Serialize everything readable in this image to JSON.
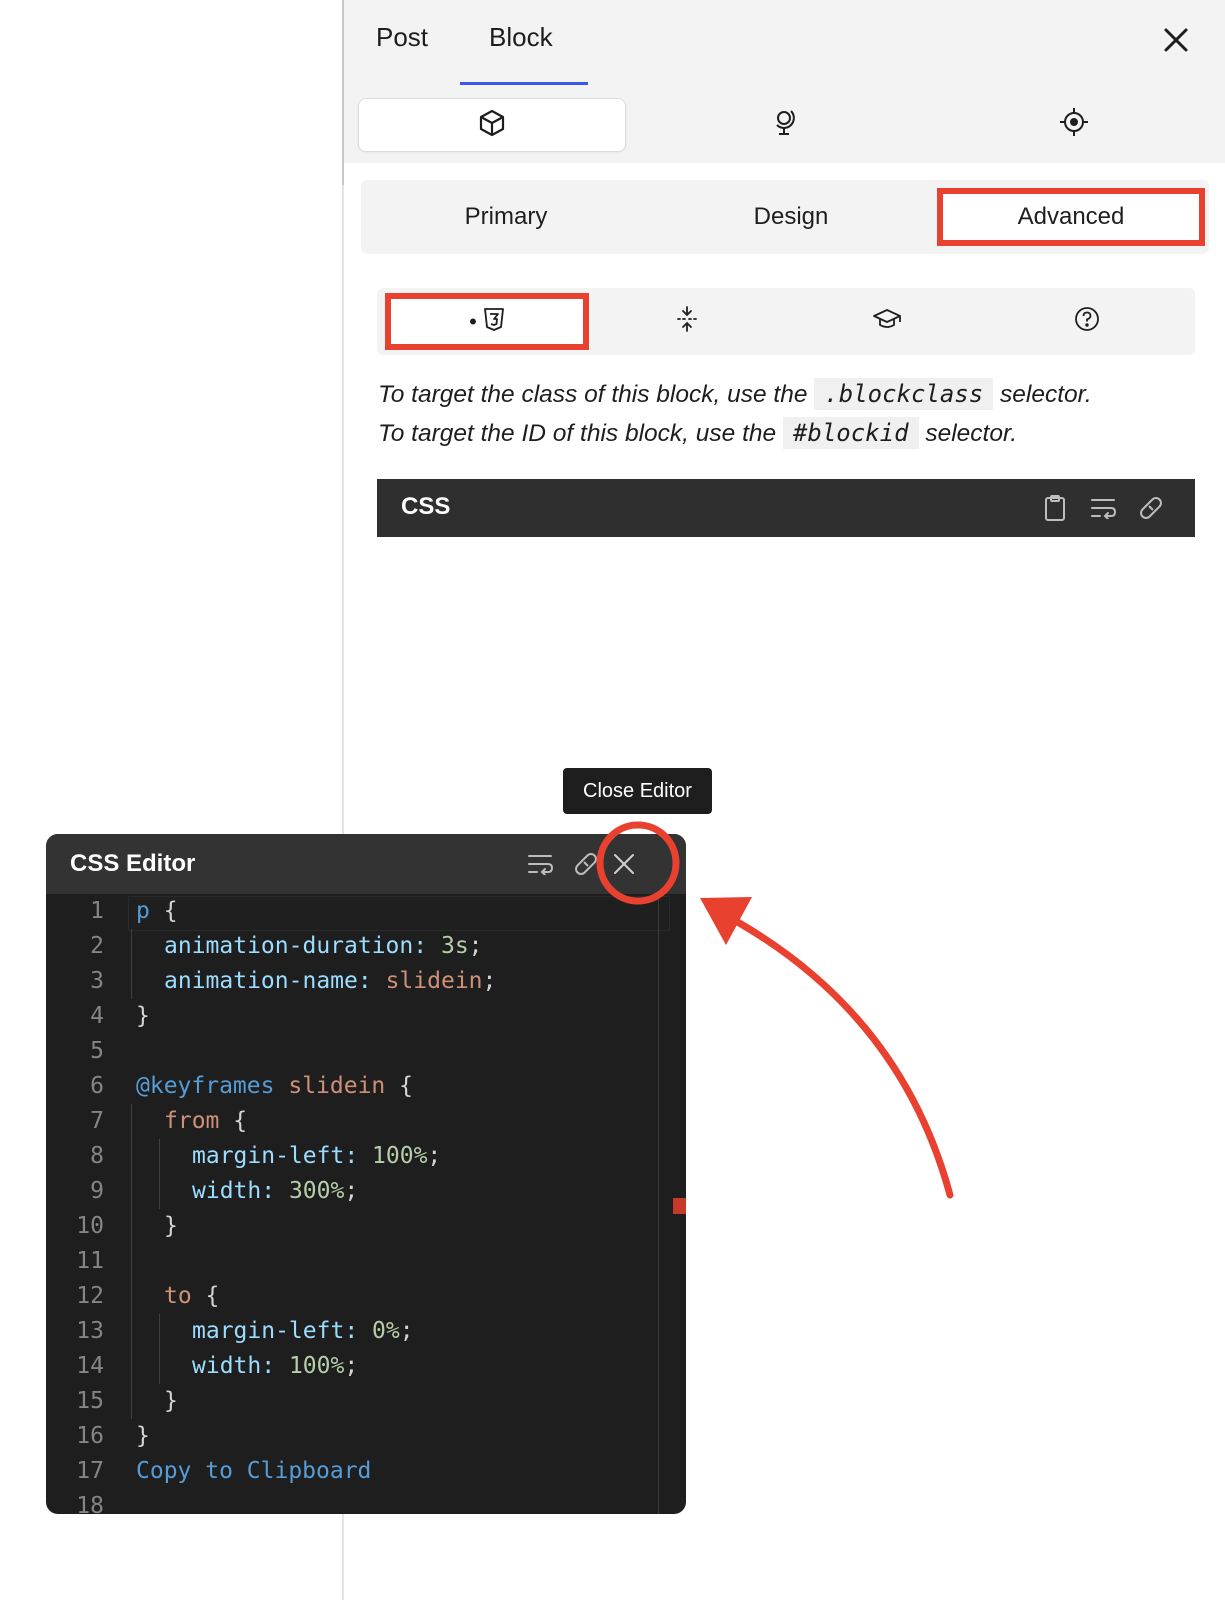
{
  "sidebar": {
    "tabs": [
      {
        "label": "Post"
      },
      {
        "label": "Block"
      }
    ],
    "close_icon": "close-icon",
    "icon_tabs": [
      "cube-icon",
      "globe-stand-icon",
      "target-icon"
    ],
    "segments": [
      {
        "label": "Primary"
      },
      {
        "label": "Design"
      },
      {
        "label": "Advanced"
      }
    ],
    "subtabs": [
      "css3-icon",
      "compress-icon",
      "graduation-cap-icon",
      "help-icon"
    ],
    "help": {
      "line1_pre": "To target the class of this block, use the",
      "line1_code": ".blockclass",
      "line1_post": "selector.",
      "line2_pre": "To target the ID of this block, use the",
      "line2_code": "#blockid",
      "line2_post": "selector."
    },
    "css_bar": {
      "title": "CSS"
    }
  },
  "tooltip": {
    "text": "Close Editor"
  },
  "editor": {
    "title": "CSS Editor",
    "lines": [
      "1",
      "2",
      "3",
      "4",
      "5",
      "6",
      "7",
      "8",
      "9",
      "10",
      "11",
      "12",
      "13",
      "14",
      "15",
      "16",
      "17",
      "18"
    ],
    "code": {
      "l1_sel": "p",
      "l1_brace": " {",
      "l2_prop": "animation-duration:",
      "l2_val": "3s",
      "l2_end": ";",
      "l3_prop": "animation-name:",
      "l3_val": "slidein",
      "l3_end": ";",
      "l4": "}",
      "l6_at": "@keyframes",
      "l6_name": "slidein",
      "l6_brace": " {",
      "l7_kw": "from",
      "l7_brace": " {",
      "l8_prop": "margin-left:",
      "l8_val": "100%",
      "l8_end": ";",
      "l9_prop": "width:",
      "l9_val": "300%",
      "l9_end": ";",
      "l10": "}",
      "l12_kw": "to",
      "l12_brace": " {",
      "l13_prop": "margin-left:",
      "l13_val": "0%",
      "l13_end": ";",
      "l14_prop": "width:",
      "l14_val": "100%",
      "l14_end": ";",
      "l15": "}",
      "l16": "}",
      "l17": "Copy to Clipboard"
    }
  },
  "colors": {
    "highlight_red": "#e8412f",
    "accent_blue": "#3858e9",
    "editor_bg": "#1e1e1e"
  }
}
